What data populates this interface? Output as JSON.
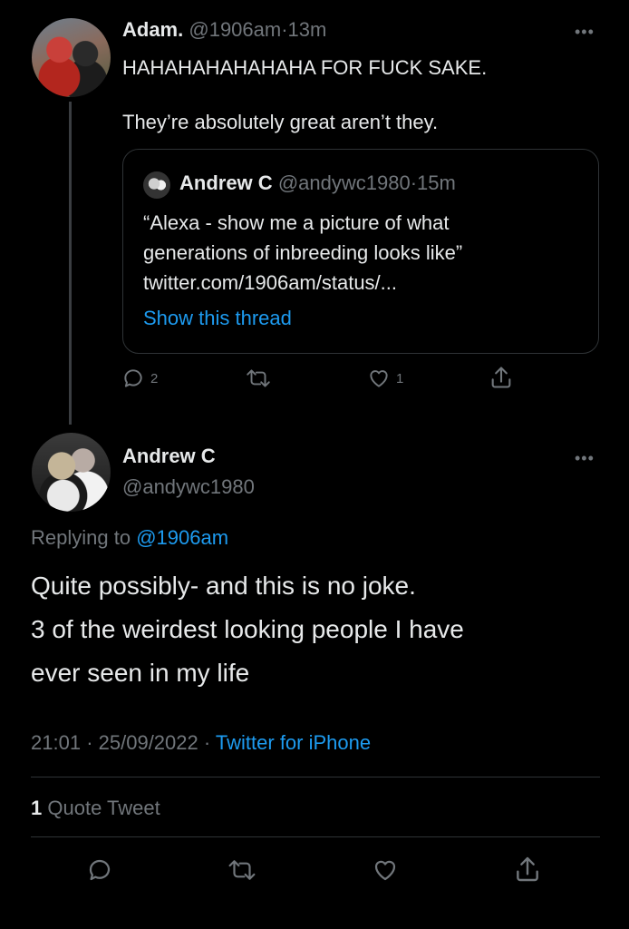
{
  "parent_tweet": {
    "name": "Adam.",
    "handle": "@1906am",
    "separator": "·",
    "time": "13m",
    "text": "HAHAHAHAHAHAHA FOR FUCK SAKE.\n\nThey’re absolutely great aren’t they.",
    "more_icon": "more-dots-icon",
    "quoted_tweet": {
      "name": "Andrew C",
      "handle": "@andywc1980",
      "separator": "·",
      "time": "15m",
      "text": "“Alexa - show me a picture of what\ngenerations of inbreeding looks like”\ntwitter.com/1906am/status/...",
      "show_thread": "Show this thread"
    },
    "actions": {
      "reply_count": "2",
      "retweet_count": "",
      "like_count": "1"
    }
  },
  "main_tweet": {
    "name": "Andrew C",
    "handle": "@andywc1980",
    "replying_prefix": "Replying to",
    "replying_to": "@1906am",
    "text": "Quite possibly- and this is no joke.\n3 of the weirdest looking people I have\never seen in my life",
    "time": "21:01",
    "separator": "·",
    "date": "25/09/2022",
    "separator2": "·",
    "source": "Twitter for iPhone",
    "quote_count": "1",
    "quote_label": "Quote Tweet"
  },
  "colors": {
    "background": "#000000",
    "text": "#e7e9ea",
    "muted": "#71767b",
    "link": "#1d9bf0",
    "border": "#2f3336"
  }
}
